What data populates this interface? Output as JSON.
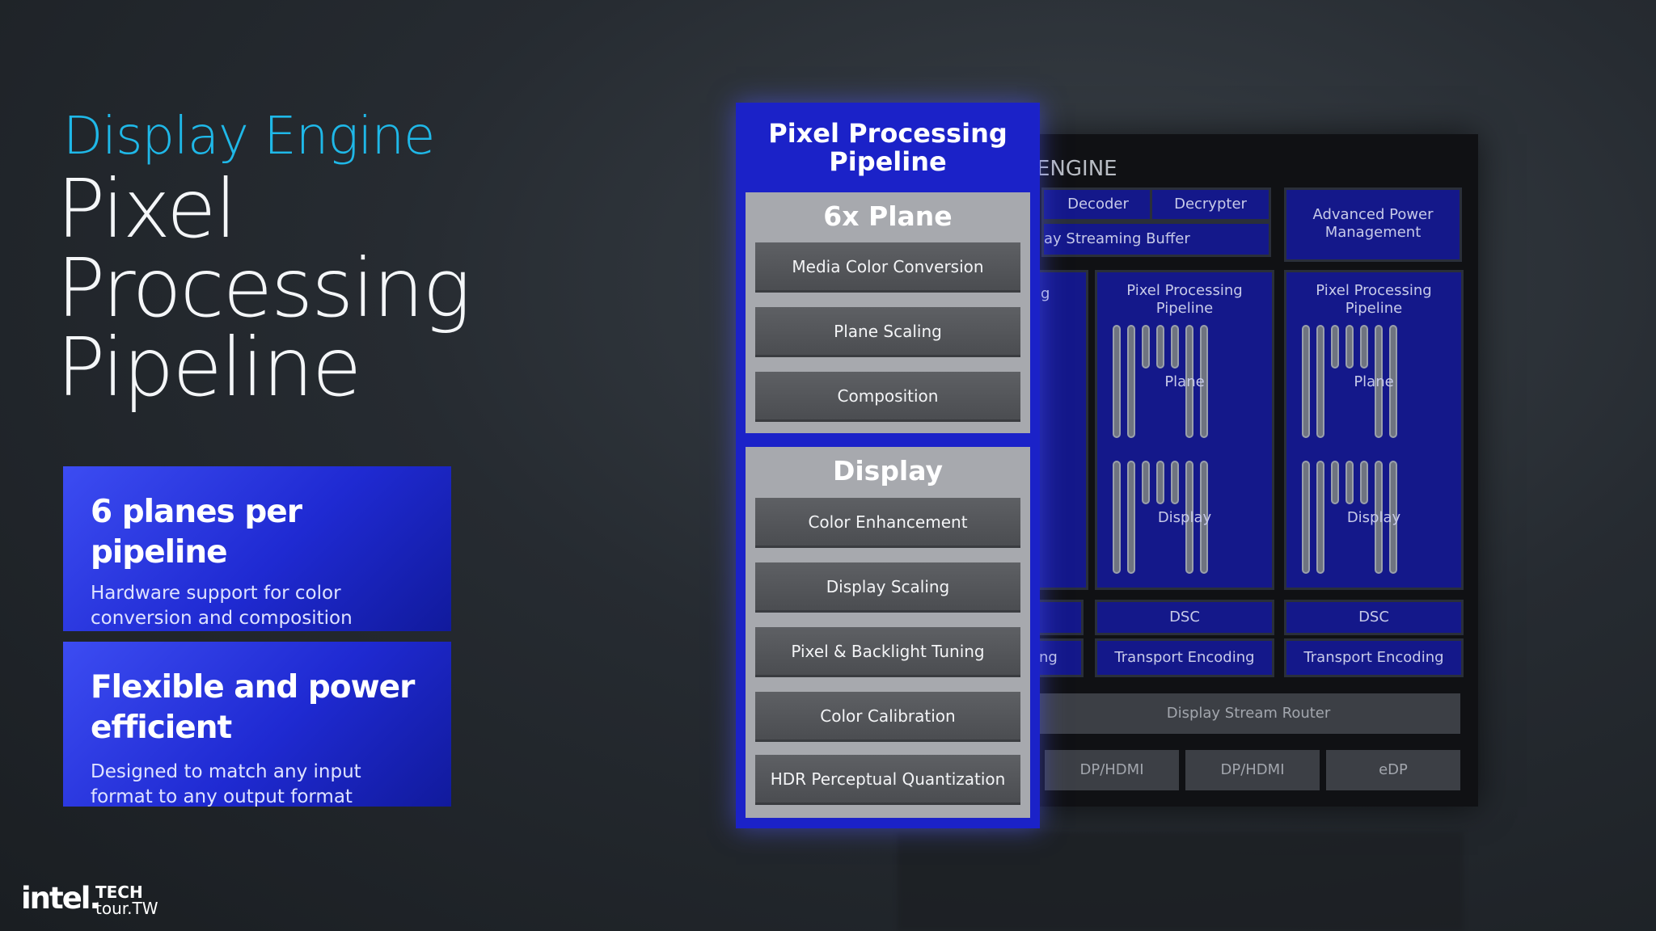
{
  "headline": {
    "subtitle": "Display Engine",
    "title_lines": [
      "Pixel",
      "Processing",
      "Pipeline"
    ]
  },
  "features": [
    {
      "title": "6 planes per pipeline",
      "desc": "Hardware support for color conversion and composition"
    },
    {
      "title": "Flexible and power efficient",
      "desc": "Designed to match any input format to any output format"
    }
  ],
  "pipeline_panel": {
    "title": "Pixel Processing Pipeline",
    "plane_section": {
      "title": "6x Plane",
      "stages": [
        "Media Color Conversion",
        "Plane Scaling",
        "Composition"
      ]
    },
    "display_section": {
      "title": "Display",
      "stages": [
        "Color Enhancement",
        "Display Scaling",
        "Pixel & Backlight Tuning",
        "Color Calibration",
        "HDR Perceptual Quantization"
      ]
    }
  },
  "engine_bg": {
    "title": "ENGINE",
    "decoder": "Decoder",
    "decrypter": "Decrypter",
    "apm": "Advanced Power Management",
    "buffer": "ay Streaming Buffer",
    "cut_g": "g",
    "cut_ng": "ng",
    "pipelines": [
      {
        "title": "Pixel Processing Pipeline",
        "plane": "Plane",
        "display": "Display",
        "dsc": "DSC",
        "transport": "Transport Encoding"
      },
      {
        "title": "Pixel Processing Pipeline",
        "plane": "Plane",
        "display": "Display",
        "dsc": "DSC",
        "transport": "Transport Encoding"
      }
    ],
    "router": "Display Stream Router",
    "ports": [
      "DP/HDMI",
      "DP/HDMI",
      "eDP"
    ]
  },
  "logos": {
    "intel": "intel.",
    "tech_line1": "TECH",
    "tech_line2": "tour.TW"
  },
  "colors": {
    "accent_cyan": "#1fb8e8",
    "panel_blue": "#1b22c8",
    "stage_grey": "#4b4d51"
  }
}
